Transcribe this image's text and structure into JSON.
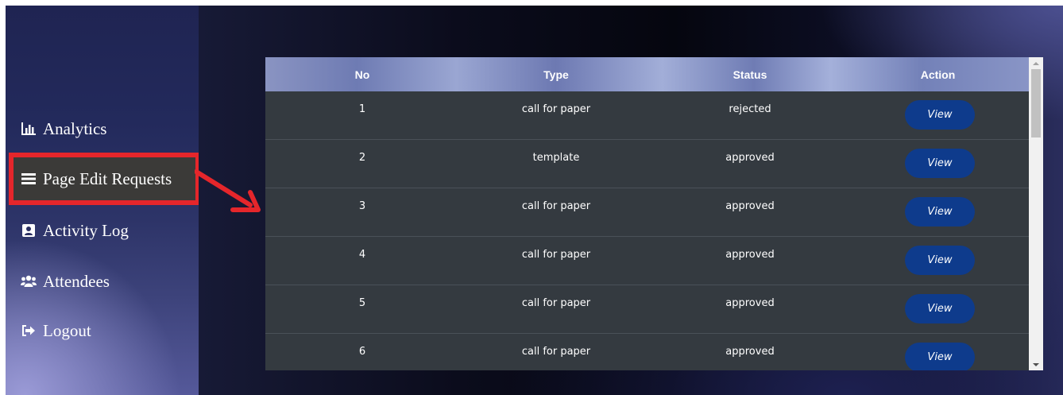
{
  "sidebar": {
    "items": [
      {
        "label": "Analytics",
        "icon": "bar-chart-icon"
      },
      {
        "label": "Page Edit Requests",
        "icon": "menu-icon",
        "active": true
      },
      {
        "label": "Activity Log",
        "icon": "address-book-icon"
      },
      {
        "label": "Attendees",
        "icon": "users-icon"
      },
      {
        "label": "Logout",
        "icon": "sign-out-icon"
      }
    ]
  },
  "table": {
    "headers": [
      "No",
      "Type",
      "Status",
      "Action"
    ],
    "rows": [
      {
        "no": "1",
        "type": "call for paper",
        "status": "rejected",
        "action": "View"
      },
      {
        "no": "2",
        "type": "template",
        "status": "approved",
        "action": "View"
      },
      {
        "no": "3",
        "type": "call for paper",
        "status": "approved",
        "action": "View"
      },
      {
        "no": "4",
        "type": "call for paper",
        "status": "approved",
        "action": "View"
      },
      {
        "no": "5",
        "type": "call for paper",
        "status": "approved",
        "action": "View"
      },
      {
        "no": "6",
        "type": "call for paper",
        "status": "approved",
        "action": "View"
      }
    ]
  },
  "colors": {
    "highlight": "#e5262b",
    "button": "#0e3b8c",
    "table_body": "#343a40"
  }
}
